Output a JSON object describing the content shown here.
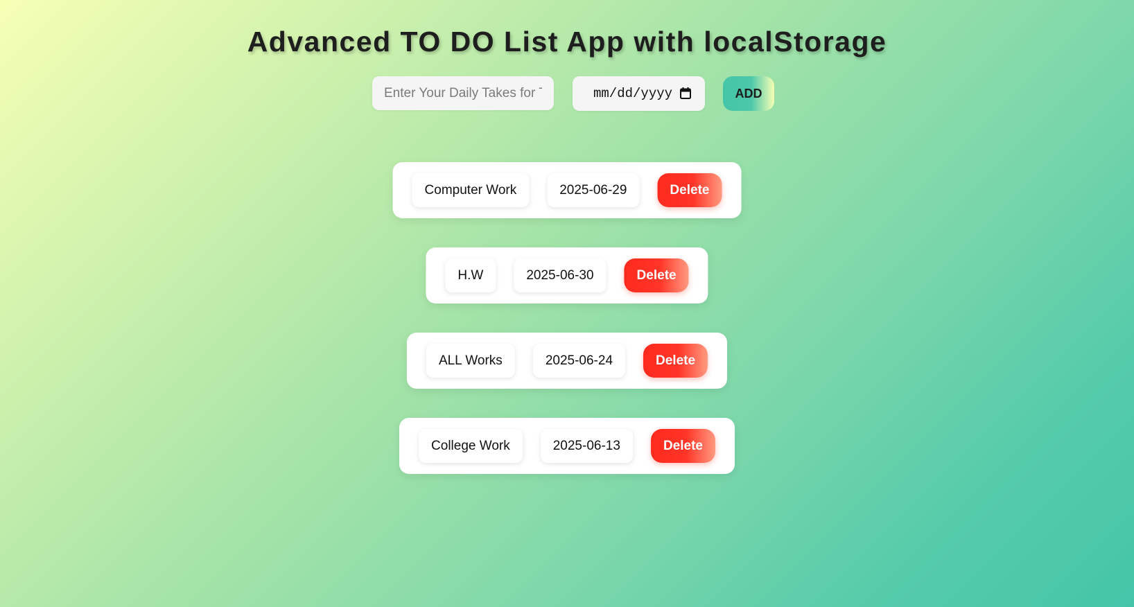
{
  "header": {
    "title": "Advanced TO DO List App with localStorage"
  },
  "form": {
    "task_placeholder": "Enter Your Daily Takes for The Day",
    "date_placeholder": "mm/dd/yyyy",
    "add_label": "ADD"
  },
  "todos": [
    {
      "task": "Computer Work",
      "date": "2025-06-29",
      "delete_label": "Delete"
    },
    {
      "task": "H.W",
      "date": "2025-06-30",
      "delete_label": "Delete"
    },
    {
      "task": "ALL Works",
      "date": "2025-06-24",
      "delete_label": "Delete"
    },
    {
      "task": "College Work",
      "date": "2025-06-13",
      "delete_label": "Delete"
    }
  ],
  "icons": {
    "date_picker": "calendar-icon"
  },
  "colors": {
    "delete": "#ff2a1e",
    "add": "#45c5a8",
    "background_start": "#f6ffb4",
    "background_end": "#45c5a8"
  }
}
